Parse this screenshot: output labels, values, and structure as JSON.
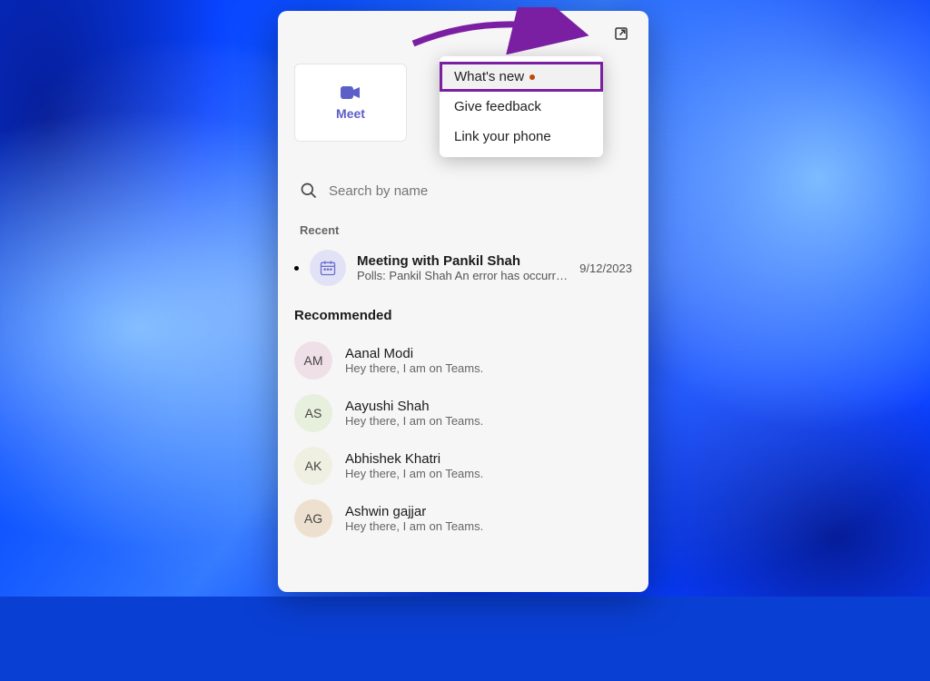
{
  "meetButton": {
    "label": "Meet"
  },
  "search": {
    "placeholder": "Search by name"
  },
  "menu": {
    "items": [
      {
        "label": "What's new",
        "hasDot": true
      },
      {
        "label": "Give feedback"
      },
      {
        "label": "Link your phone"
      }
    ]
  },
  "sections": {
    "recentLabel": "Recent",
    "recommendedLabel": "Recommended"
  },
  "recent": [
    {
      "title": "Meeting with Pankil Shah",
      "subtitle": "Polls: Pankil Shah An error has occurre…",
      "date": "9/12/2023"
    }
  ],
  "recommended": [
    {
      "initials": "AM",
      "name": "Aanal Modi",
      "subtitle": "Hey there, I am on Teams.",
      "bg": "#efe0e8"
    },
    {
      "initials": "AS",
      "name": "Aayushi Shah",
      "subtitle": "Hey there, I am on Teams.",
      "bg": "#e7efdd"
    },
    {
      "initials": "AK",
      "name": "Abhishek Khatri",
      "subtitle": "Hey there, I am on Teams.",
      "bg": "#efefe2"
    },
    {
      "initials": "AG",
      "name": "Ashwin gajjar",
      "subtitle": "Hey there, I am on Teams.",
      "bg": "#eee0cf"
    }
  ],
  "colors": {
    "accent": "#5b5fc7",
    "highlight": "#7b1fa2"
  }
}
